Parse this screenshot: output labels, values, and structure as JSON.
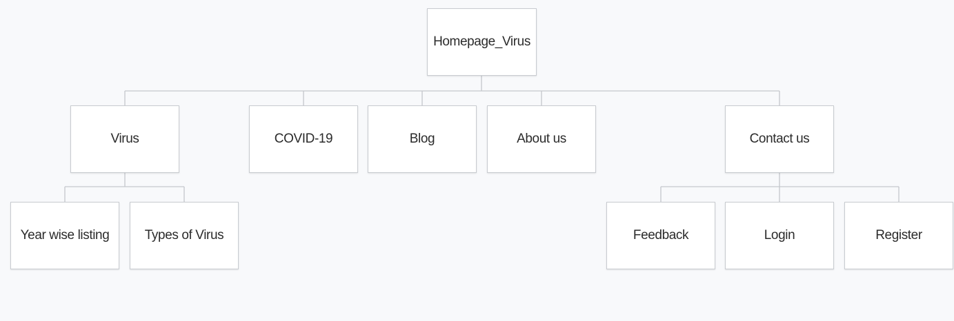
{
  "diagram": {
    "root": {
      "label": "Homepage_Virus"
    },
    "level1": {
      "virus": {
        "label": "Virus"
      },
      "covid": {
        "label": "COVID-19"
      },
      "blog": {
        "label": "Blog"
      },
      "about": {
        "label": "About us"
      },
      "contact": {
        "label": "Contact us"
      }
    },
    "level2": {
      "year_wise": {
        "label": "Year wise listing"
      },
      "types": {
        "label": "Types of Virus"
      },
      "feedback": {
        "label": "Feedback"
      },
      "login": {
        "label": "Login"
      },
      "register": {
        "label": "Register"
      }
    },
    "edges": [
      [
        "Homepage_Virus",
        "Virus"
      ],
      [
        "Homepage_Virus",
        "COVID-19"
      ],
      [
        "Homepage_Virus",
        "Blog"
      ],
      [
        "Homepage_Virus",
        "About us"
      ],
      [
        "Homepage_Virus",
        "Contact us"
      ],
      [
        "Virus",
        "Year wise listing"
      ],
      [
        "Virus",
        "Types of Virus"
      ],
      [
        "Contact us",
        "Feedback"
      ],
      [
        "Contact us",
        "Login"
      ],
      [
        "Contact us",
        "Register"
      ]
    ],
    "colors": {
      "background": "#f8f9fb",
      "node_fill": "#ffffff",
      "node_border": "#c8cbd0",
      "connector": "#c4c7cc",
      "text": "#2b2b2b"
    }
  }
}
